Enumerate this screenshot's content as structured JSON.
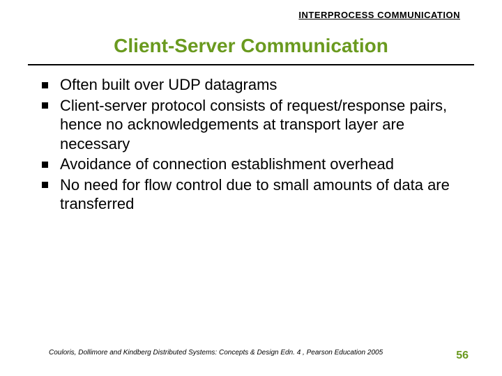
{
  "header": {
    "label": "INTERPROCESS COMMUNICATION"
  },
  "title": "Client-Server Communication",
  "bullets": [
    "Often built over UDP datagrams",
    "Client-server protocol consists of request/response pairs, hence no acknowledgements at transport layer are necessary",
    " Avoidance of connection establishment overhead",
    " No need for flow control due to small amounts of data are transferred"
  ],
  "footer": {
    "citation": "Couloris, Dollimore and Kindberg  Distributed Systems: Concepts & Design  Edn. 4 , Pearson Education 2005",
    "page": "56"
  }
}
